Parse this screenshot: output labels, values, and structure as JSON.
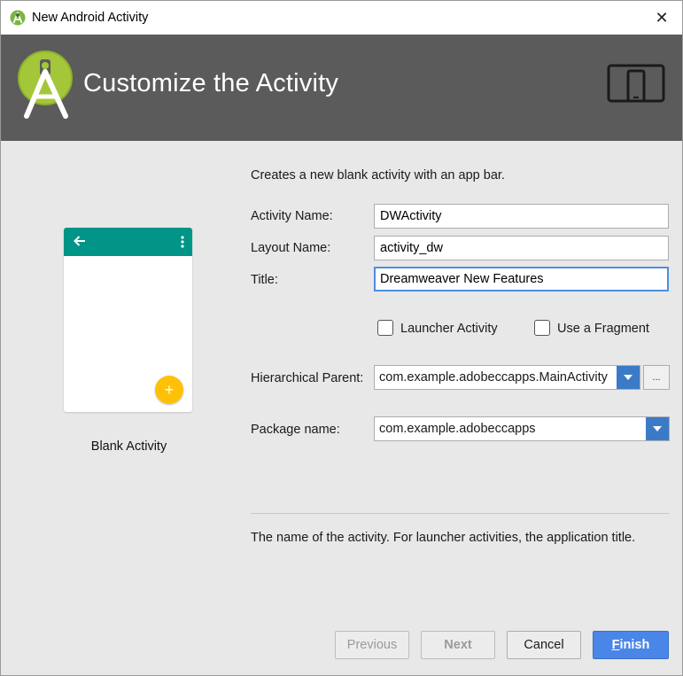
{
  "window": {
    "title": "New Android Activity",
    "close_glyph": "✕"
  },
  "banner": {
    "heading": "Customize the Activity"
  },
  "preview": {
    "fab_glyph": "+",
    "label": "Blank Activity"
  },
  "form": {
    "description": "Creates a new blank activity with an app bar.",
    "activity_name": {
      "label": "Activity Name:",
      "value": "DWActivity"
    },
    "layout_name": {
      "label": "Layout Name:",
      "value": "activity_dw"
    },
    "title": {
      "label": "Title:",
      "value": "Dreamweaver New Features"
    },
    "launcher_activity": {
      "label": "Launcher Activity",
      "checked": false
    },
    "use_fragment": {
      "label": "Use a Fragment",
      "checked": false
    },
    "hierarchical_parent": {
      "label": "Hierarchical Parent:",
      "value": "com.example.adobeccapps.MainActivity",
      "browse_label": "..."
    },
    "package_name": {
      "label": "Package name:",
      "value": "com.example.adobeccapps"
    },
    "help_text": "The name of the activity. For launcher activities, the application title."
  },
  "buttons": {
    "previous": "Previous",
    "next": "Next",
    "cancel": "Cancel",
    "finish_mnemonic": "F",
    "finish_rest": "inish"
  },
  "colors": {
    "banner": "#5b5b5b",
    "appbar": "#009587",
    "fab": "#ffc107",
    "accent": "#4a86e8",
    "android_green": "#a4c639"
  }
}
